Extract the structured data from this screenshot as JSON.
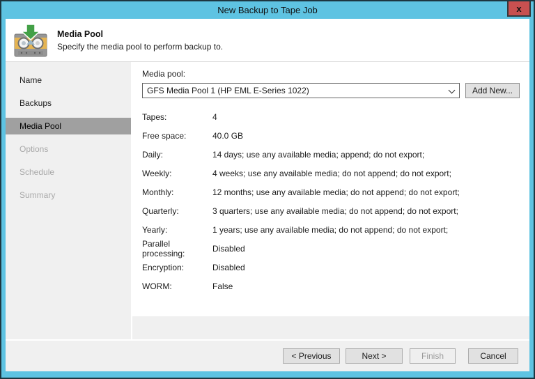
{
  "window": {
    "title": "New Backup to Tape Job",
    "close_glyph": "x"
  },
  "header": {
    "title": "Media Pool",
    "subtitle": "Specify the media pool to perform backup to.",
    "icon": "tape-cassette-green-down-arrow-icon"
  },
  "sidebar": {
    "items": [
      {
        "label": "Name",
        "state": "completed"
      },
      {
        "label": "Backups",
        "state": "completed"
      },
      {
        "label": "Media Pool",
        "state": "selected"
      },
      {
        "label": "Options",
        "state": "upcoming"
      },
      {
        "label": "Schedule",
        "state": "upcoming"
      },
      {
        "label": "Summary",
        "state": "upcoming"
      }
    ]
  },
  "main": {
    "media_pool": {
      "label": "Media pool:",
      "selected_value": "GFS Media Pool 1 (HP EML E-Series 1022)",
      "add_new_label": "Add New..."
    },
    "details": [
      {
        "label": "Tapes:",
        "value": "4"
      },
      {
        "label": "Free space:",
        "value": "40.0 GB"
      },
      {
        "label": "Daily:",
        "value": "14 days; use any available media; append; do not export;"
      },
      {
        "label": "Weekly:",
        "value": "4 weeks; use any available media; do not append; do not export;"
      },
      {
        "label": "Monthly:",
        "value": "12 months; use any available media; do not append; do not export;"
      },
      {
        "label": "Quarterly:",
        "value": "3 quarters; use any available media; do not append; do not export;"
      },
      {
        "label": "Yearly:",
        "value": "1 years; use any available media; do not append; do not export;"
      },
      {
        "label": "Parallel processing:",
        "value": "Disabled"
      },
      {
        "label": "Encryption:",
        "value": "Disabled"
      },
      {
        "label": "WORM:",
        "value": "False"
      }
    ]
  },
  "footer": {
    "buttons": [
      {
        "label": "< Previous",
        "state": "enabled"
      },
      {
        "label": "Next >",
        "state": "default"
      },
      {
        "label": "Finish",
        "state": "disabled"
      },
      {
        "label": "Cancel",
        "state": "enabled"
      }
    ]
  },
  "colors": {
    "titlebar_blue": "#5ec3e2",
    "frame_outline": "#1d3640",
    "close_red": "#c75050",
    "sidebar_gray": "#f0f0f0",
    "selected_step_gray": "#a0a0a0",
    "next_button_accent": "#3a79b8",
    "arrow_green": "#43a047",
    "cassette_tan": "#e5b452"
  }
}
